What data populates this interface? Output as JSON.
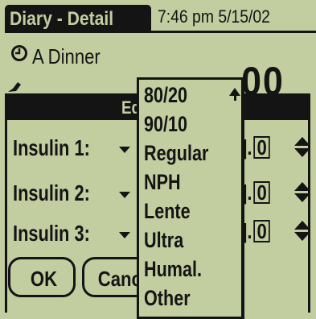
{
  "header": {
    "title": "Diary - Detail",
    "datetime": "7:46 pm 5/15/02"
  },
  "record": {
    "name": "A Dinner",
    "big_digits": "00"
  },
  "dialog": {
    "title": "Ed",
    "rows": [
      {
        "label": "Insulin 1:",
        "prefix": "].",
        "digit": "0"
      },
      {
        "label": "Insulin 2:",
        "prefix": "].",
        "digit": "0"
      },
      {
        "label": "Insulin 3:",
        "prefix": "].",
        "digit": "0"
      }
    ],
    "ok_label": "OK",
    "cancel_label": "Canc"
  },
  "popup": {
    "options": [
      "80/20",
      "90/10",
      "Regular",
      "NPH",
      "Lente",
      "Ultra",
      "Humal.",
      "Other"
    ]
  },
  "icons": {
    "clock": "clock-icon",
    "pencil": "pencil-icon",
    "scroll": "scroll-up-arrow-icon",
    "dropdown": "dropdown-arrow-icon",
    "stepper": "up-down-stepper-icon"
  },
  "colors": {
    "background": "#c2cda0",
    "ink": "#141414"
  }
}
